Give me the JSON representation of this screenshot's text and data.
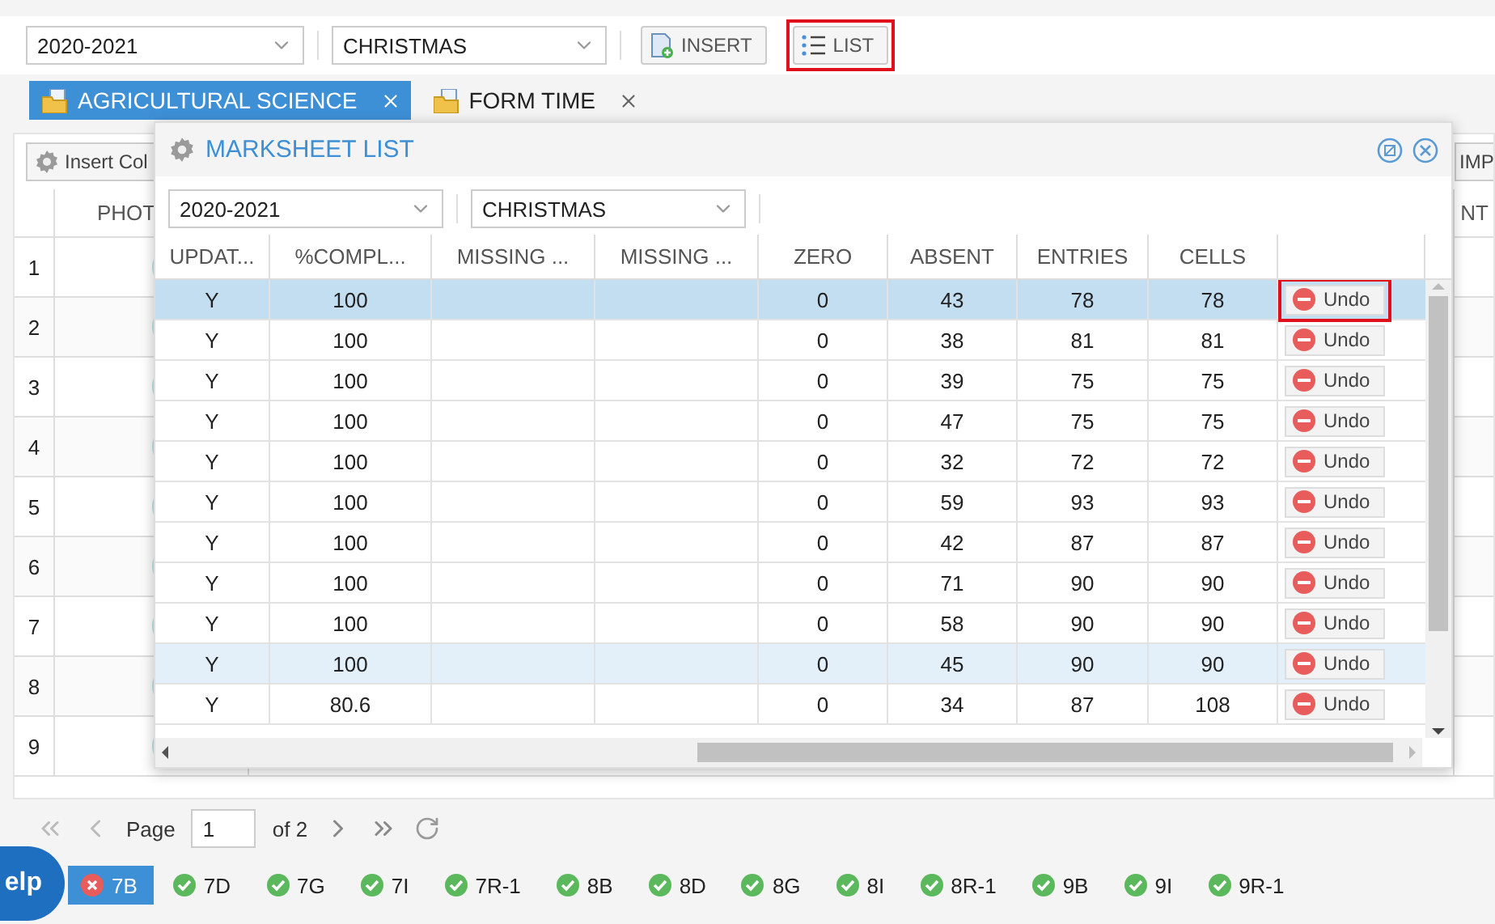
{
  "top_toolbar": {
    "year": "2020-2021",
    "term": "CHRISTMAS",
    "buttons": [
      {
        "label": "INSERT",
        "kind": "insert",
        "highlighted": false
      },
      {
        "label": "LIST",
        "kind": "list",
        "highlighted": true
      }
    ]
  },
  "subject_tabs": [
    {
      "label": "AGRICULTURAL SCIENCE",
      "selected": true
    },
    {
      "label": "FORM TIME",
      "selected": false
    }
  ],
  "grid": {
    "left_button": "Insert Col",
    "right_button": "IMP",
    "columns": [
      "PHOT",
      "NT"
    ],
    "rows": [
      "1",
      "2",
      "3",
      "4",
      "5",
      "6",
      "7",
      "8",
      "9"
    ]
  },
  "dialog": {
    "title": "MARKSHEET LIST",
    "year": "2020-2021",
    "term": "CHRISTMAS",
    "columns": [
      "UPDAT...",
      "%COMPL...",
      "MISSING ...",
      "MISSING ...",
      "ZERO",
      "ABSENT",
      "ENTRIES",
      "CELLS"
    ],
    "rows": [
      {
        "updated": "Y",
        "complete": "100",
        "zero": "0",
        "absent": "43",
        "entries": "78",
        "cells": "78",
        "action": "Undo",
        "selected": true,
        "hover": false,
        "highlighted": true
      },
      {
        "updated": "Y",
        "complete": "100",
        "zero": "0",
        "absent": "38",
        "entries": "81",
        "cells": "81",
        "action": "Undo",
        "selected": false,
        "hover": false,
        "highlighted": false
      },
      {
        "updated": "Y",
        "complete": "100",
        "zero": "0",
        "absent": "39",
        "entries": "75",
        "cells": "75",
        "action": "Undo",
        "selected": false,
        "hover": false,
        "highlighted": false
      },
      {
        "updated": "Y",
        "complete": "100",
        "zero": "0",
        "absent": "47",
        "entries": "75",
        "cells": "75",
        "action": "Undo",
        "selected": false,
        "hover": false,
        "highlighted": false
      },
      {
        "updated": "Y",
        "complete": "100",
        "zero": "0",
        "absent": "32",
        "entries": "72",
        "cells": "72",
        "action": "Undo",
        "selected": false,
        "hover": false,
        "highlighted": false
      },
      {
        "updated": "Y",
        "complete": "100",
        "zero": "0",
        "absent": "59",
        "entries": "93",
        "cells": "93",
        "action": "Undo",
        "selected": false,
        "hover": false,
        "highlighted": false
      },
      {
        "updated": "Y",
        "complete": "100",
        "zero": "0",
        "absent": "42",
        "entries": "87",
        "cells": "87",
        "action": "Undo",
        "selected": false,
        "hover": false,
        "highlighted": false
      },
      {
        "updated": "Y",
        "complete": "100",
        "zero": "0",
        "absent": "71",
        "entries": "90",
        "cells": "90",
        "action": "Undo",
        "selected": false,
        "hover": false,
        "highlighted": false
      },
      {
        "updated": "Y",
        "complete": "100",
        "zero": "0",
        "absent": "58",
        "entries": "90",
        "cells": "90",
        "action": "Undo",
        "selected": false,
        "hover": false,
        "highlighted": false
      },
      {
        "updated": "Y",
        "complete": "100",
        "zero": "0",
        "absent": "45",
        "entries": "90",
        "cells": "90",
        "action": "Undo",
        "selected": false,
        "hover": true,
        "highlighted": false
      },
      {
        "updated": "Y",
        "complete": "80.6",
        "zero": "0",
        "absent": "34",
        "entries": "87",
        "cells": "108",
        "action": "Undo",
        "selected": false,
        "hover": false,
        "highlighted": false
      }
    ]
  },
  "pager": {
    "label": "Page",
    "page": "1",
    "total": "of 2"
  },
  "help": "elp",
  "class_tabs": [
    {
      "label": "7B",
      "selected": true,
      "kind": "error"
    },
    {
      "label": "7D",
      "selected": false,
      "kind": "ok"
    },
    {
      "label": "7G",
      "selected": false,
      "kind": "ok"
    },
    {
      "label": "7I",
      "selected": false,
      "kind": "ok"
    },
    {
      "label": "7R-1",
      "selected": false,
      "kind": "ok"
    },
    {
      "label": "8B",
      "selected": false,
      "kind": "ok"
    },
    {
      "label": "8D",
      "selected": false,
      "kind": "ok"
    },
    {
      "label": "8G",
      "selected": false,
      "kind": "ok"
    },
    {
      "label": "8I",
      "selected": false,
      "kind": "ok"
    },
    {
      "label": "8R-1",
      "selected": false,
      "kind": "ok"
    },
    {
      "label": "9B",
      "selected": false,
      "kind": "ok"
    },
    {
      "label": "9I",
      "selected": false,
      "kind": "ok"
    },
    {
      "label": "9R-1",
      "selected": false,
      "kind": "ok"
    }
  ]
}
